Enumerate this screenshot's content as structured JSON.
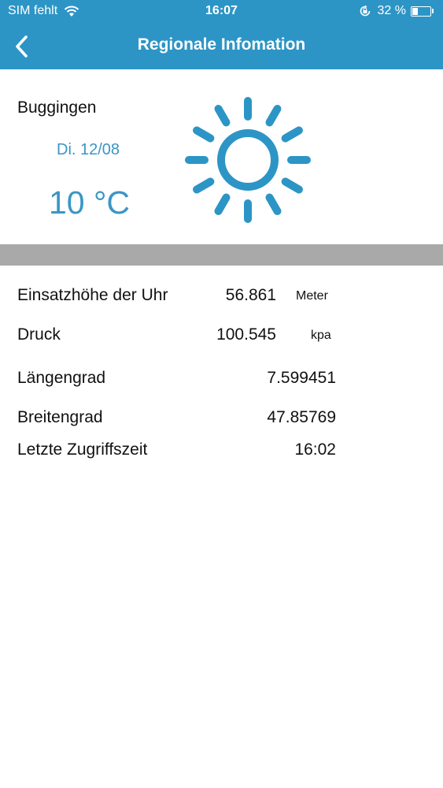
{
  "status_bar": {
    "carrier": "SIM fehlt",
    "time": "16:07",
    "battery_percent_label": "32 %",
    "battery_level": 0.32,
    "icons": [
      "wifi-icon",
      "rotation-lock-icon",
      "battery-icon"
    ]
  },
  "nav": {
    "back_icon": "chevron-left-icon",
    "title": "Regionale Infomation"
  },
  "weather": {
    "city": "Buggingen",
    "date": "Di. 12/08",
    "temperature": "10 °C",
    "icon": "sun-icon"
  },
  "info": {
    "rows": [
      {
        "label": "Einsatzhöhe der Uhr",
        "value": "56.861",
        "unit": "Meter"
      },
      {
        "label": "Druck",
        "value": "100.545",
        "unit": "kpa"
      },
      {
        "label": "Längengrad",
        "value": "7.599451",
        "unit": ""
      },
      {
        "label": "Breitengrad",
        "value": "47.85769",
        "unit": ""
      },
      {
        "label": "Letzte Zugriffszeit",
        "value": "16:02",
        "unit": ""
      }
    ]
  },
  "colors": {
    "header": "#2c95c6",
    "accent": "#3a96c4",
    "divider": "#a9a9a9",
    "text": "#111111"
  }
}
